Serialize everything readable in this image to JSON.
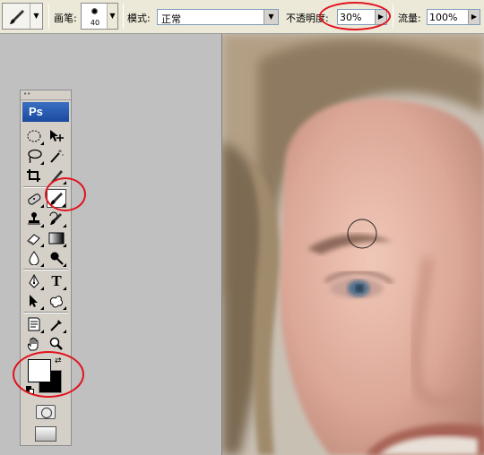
{
  "options_bar": {
    "brush_label": "画笔:",
    "brush_size": "40",
    "mode_label": "模式:",
    "mode_value": "正常",
    "opacity_label": "不透明度:",
    "opacity_value": "30%",
    "flow_label": "流量:",
    "flow_value": "100%"
  },
  "toolbox": {
    "logo": "Ps",
    "type_tool_glyph": "T",
    "active_tool": "brush-tool",
    "foreground_color": "#ffffff",
    "background_color": "#000000"
  },
  "canvas": {
    "content": "photo-of-face"
  },
  "annotations": {
    "color": "#e0141e",
    "highlighted": [
      "opacity-field",
      "brush-tool",
      "color-swatches"
    ]
  }
}
